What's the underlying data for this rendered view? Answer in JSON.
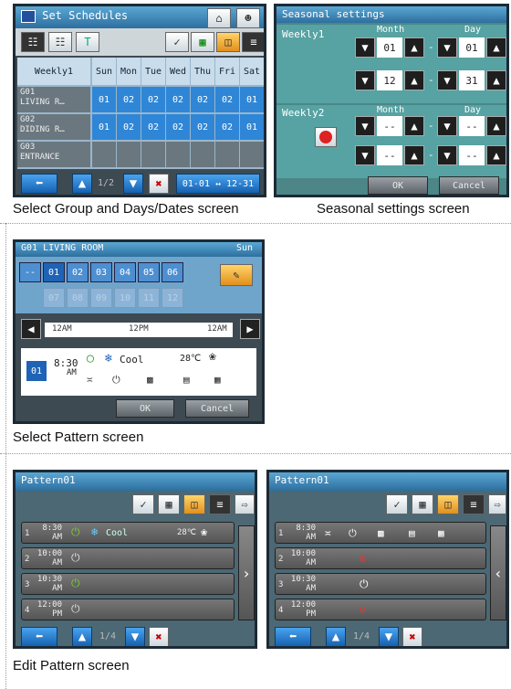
{
  "captions": {
    "select_group": "Select Group and Days/Dates screen",
    "seasonal": "Seasonal settings screen",
    "select_pattern": "Select Pattern screen",
    "edit_pattern": "Edit Pattern screen"
  },
  "schedules": {
    "title": "Set Schedules",
    "weekly_label": "Weekly1",
    "days": [
      "Sun",
      "Mon",
      "Tue",
      "Wed",
      "Thu",
      "Fri",
      "Sat"
    ],
    "groups": [
      {
        "id": "G01",
        "name": "LIVING R…",
        "values": [
          "01",
          "02",
          "02",
          "02",
          "02",
          "02",
          "01"
        ]
      },
      {
        "id": "G02",
        "name": "DIDING R…",
        "values": [
          "01",
          "02",
          "02",
          "02",
          "02",
          "02",
          "01"
        ]
      },
      {
        "id": "G03",
        "name": "ENTRANCE",
        "values": [
          "",
          "",
          "",
          "",
          "",
          "",
          ""
        ]
      }
    ],
    "page": "1/2",
    "date_range": "01-01 ↔ 12-31"
  },
  "seasonal": {
    "title": "Seasonal settings",
    "weekly1": "Weekly1",
    "weekly2": "Weekly2",
    "month_label": "Month",
    "day_label": "Day",
    "w1_start_month": "01",
    "w1_start_day": "01",
    "w1_end_month": "12",
    "w1_end_day": "31",
    "w2_start_month": "--",
    "w2_start_day": "--",
    "w2_end_month": "--",
    "w2_end_day": "--",
    "dash": "-",
    "ok": "OK",
    "cancel": "Cancel"
  },
  "select_pattern": {
    "title": "G01 LIVING ROOM",
    "day": "Sun",
    "patterns_row1": [
      "--",
      "01",
      "02",
      "03",
      "04",
      "05",
      "06"
    ],
    "patterns_row2": [
      "07",
      "08",
      "09",
      "10",
      "11",
      "12"
    ],
    "time_labels": [
      "12AM",
      "12PM",
      "12AM"
    ],
    "event_pattern": "01",
    "event_time": "8:30",
    "event_ampm": "AM",
    "event_mode": "Cool",
    "event_temp": "28℃",
    "ok": "OK",
    "cancel": "Cancel"
  },
  "edit_pattern": {
    "title": "Pattern01",
    "rows": [
      {
        "num": "1",
        "time": "8:30",
        "ampm": "AM",
        "mode": "Cool",
        "temp": "28℃"
      },
      {
        "num": "2",
        "time": "10:00",
        "ampm": "AM"
      },
      {
        "num": "3",
        "time": "10:30",
        "ampm": "AM"
      },
      {
        "num": "4",
        "time": "12:00",
        "ampm": "PM"
      }
    ],
    "page": "1/4"
  }
}
